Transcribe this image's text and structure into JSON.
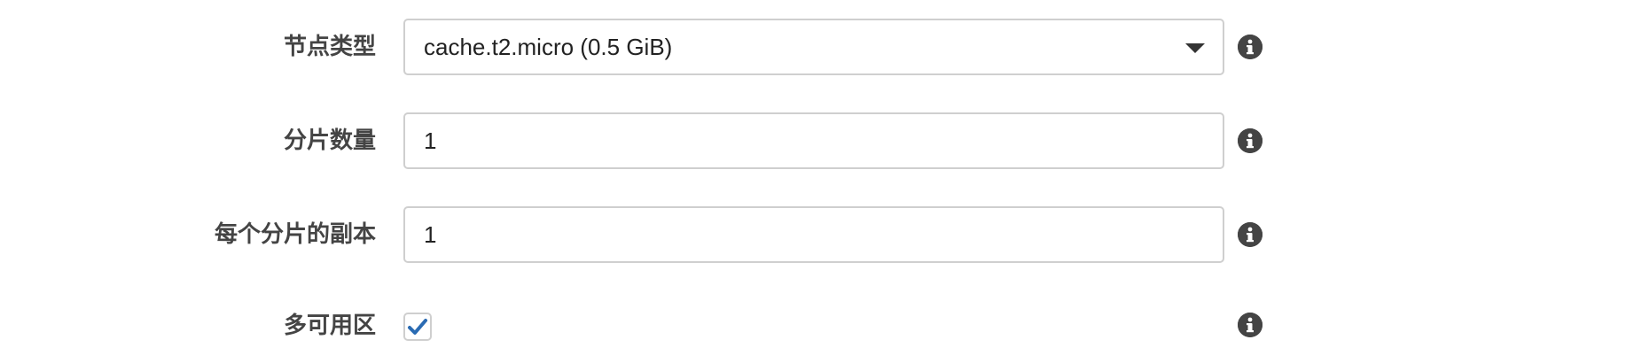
{
  "form": {
    "node_type": {
      "label": "节点类型",
      "value": "cache.t2.micro (0.5 GiB)",
      "icon": "chevron-down-icon",
      "info_icon": "info-icon"
    },
    "shard_count": {
      "label": "分片数量",
      "value": "1",
      "info_icon": "info-icon"
    },
    "replicas_per_shard": {
      "label": "每个分片的副本",
      "value": "1",
      "info_icon": "info-icon"
    },
    "multi_az": {
      "label": "多可用区",
      "checked": true,
      "check_icon": "checkmark-icon",
      "check_color": "#2a6bb3",
      "info_icon": "info-icon"
    }
  }
}
